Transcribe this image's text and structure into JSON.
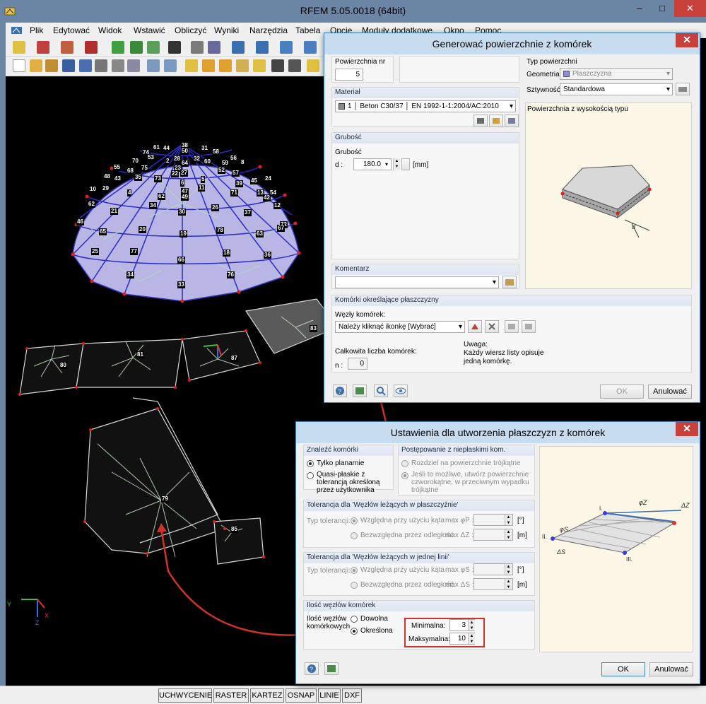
{
  "app": {
    "title": "RFEM 5.05.0018 (64bit)",
    "menu": [
      "Plik",
      "Edytować",
      "Widok",
      "Wstawić",
      "Obliczyć",
      "Wyniki",
      "Narzędzia",
      "Tabela",
      "Opcje",
      "Moduły dodatkowe",
      "Okno",
      "Pomoc"
    ],
    "window_buttons": [
      "–",
      "□",
      "✕"
    ]
  },
  "status_bar": [
    "UCHWYCENIE",
    "RASTER",
    "KARTEZ",
    "OSNAP",
    "LINIE",
    "DXF"
  ],
  "viewport": {
    "dome_labels": [
      "74",
      "61",
      "44",
      "38",
      "50",
      "31",
      "58",
      "56",
      "8",
      "70",
      "53",
      "32",
      "60",
      "59",
      "55",
      "68",
      "75",
      "2",
      "28",
      "64",
      "23",
      "52",
      "57",
      "24",
      "48",
      "43",
      "35",
      "73",
      "22",
      "27",
      "5",
      "45",
      "10",
      "6",
      "39",
      "47",
      "49",
      "11",
      "54",
      "29",
      "4",
      "62",
      "71",
      "13",
      "42",
      "62",
      "34",
      "12",
      "21",
      "26",
      "30",
      "46",
      "37",
      "72",
      "65",
      "20",
      "19",
      "78",
      "63",
      "67",
      "25",
      "77",
      "18",
      "36",
      "66",
      "34",
      "76",
      "33"
    ],
    "slab_labels": [
      "83",
      "81",
      "80",
      "87",
      "79",
      "85"
    ],
    "axis": {
      "y": "Y",
      "x": "X",
      "z": "Z"
    }
  },
  "dialog1": {
    "title": "Generować powierzchnie z komórek",
    "close": "✕",
    "surface_no_label": "Powierzchnia nr",
    "surface_no_value": "5",
    "material_label": "Materiał",
    "material_value": "1 │ Beton C30/37 │ EN 1992-1-1:2004/AC:2010",
    "thickness_group": "Grubość",
    "thickness_label": "Grubość",
    "d_label": "d :",
    "d_value": "180.0",
    "d_unit": "[mm]",
    "surface_type_label": "Typ powierzchni",
    "geometry_label": "Geometria:",
    "geometry_value": "Płaszczyzna",
    "stiffness_label": "Sztywność:",
    "stiffness_value": "Standardowa",
    "preview_title": "Powierzchnia z wysokością typu",
    "comment_label": "Komentarz",
    "cells_group": "Komórki określające płaszczyzny",
    "cell_nodes_label": "Węzły komórek:",
    "cell_nodes_value": "Należy kliknąć ikonkę [Wybrać]",
    "total_cells_label": "Całkowita liczba komórek:",
    "n_label": "n :",
    "n_value": "0",
    "note_label": "Uwaga:",
    "note_text": "Każdy wiersz listy opisuje jedną komórkę.",
    "ok": "OK",
    "cancel": "Anulować"
  },
  "dialog2": {
    "title": "Ustawienia dla utworzenia płaszczyzn z komórek",
    "close": "✕",
    "find_cells_label": "Znaleźć komórki",
    "find_opt1": "Tylko planarnie",
    "find_opt2": "Quasi-płaskie z tolerancją określoną przez użytkownika",
    "nonplanar_label": "Postępowanie z niepłaskimi kom.",
    "nonplanar_opt1": "Rozdziel na powierzchnie trójkątne",
    "nonplanar_opt2": "Jeśli to możliwe, utwórz powierzchnie czworokątne, w przeciwnym wypadku trójkątne",
    "tol_plane_label": "Tolerancja dla 'Węzłów leżących w płaszczyźnie'",
    "tol_type_label": "Typ tolerancji:",
    "tol_rel_angle": "Względna przy użyciu kąta",
    "tol_abs_dist": "Bezwzględna przez odległość",
    "max_phi_p": "max φP :",
    "max_dz": "max ΔZ :",
    "unit_deg": "[°]",
    "unit_m": "[m]",
    "tol_line_label": "Tolerancja dla 'Węzłów leżących w jednej linii'",
    "max_phi_s": "max φS :",
    "max_ds": "max ΔS :",
    "nodes_count_label": "Ilość węzłów komórek",
    "nodes_count_sub": "Ilość węzłów komórkowych",
    "opt_any": "Dowolna",
    "opt_defined": "Określona",
    "min_label": "Minimalna:",
    "min_value": "3",
    "max_label": "Maksymalna:",
    "max_value": "10",
    "ok": "OK",
    "cancel": "Anulować"
  },
  "colors": {
    "dome_fill": "#b9b6e6",
    "slab_outline": "#d8d8d8",
    "highlight_red": "#d0332b"
  }
}
